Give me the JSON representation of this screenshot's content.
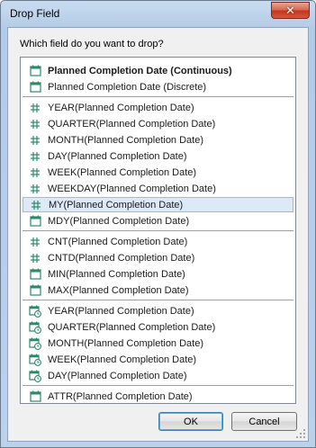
{
  "window": {
    "title": "Drop Field",
    "close_glyph": "✕"
  },
  "prompt": "Which field do you want to drop?",
  "colors": {
    "icon_green": "#2b8a67",
    "selection_bg": "#dce9f7",
    "selection_border": "#9cbde3"
  },
  "groups": [
    {
      "items": [
        {
          "label": "Planned Completion Date (Continuous)",
          "icon": "calendar-icon",
          "bold": true
        },
        {
          "label": "Planned Completion Date (Discrete)",
          "icon": "calendar-icon"
        }
      ]
    },
    {
      "items": [
        {
          "label": "YEAR(Planned Completion Date)",
          "icon": "hash-icon"
        },
        {
          "label": "QUARTER(Planned Completion Date)",
          "icon": "hash-icon"
        },
        {
          "label": "MONTH(Planned Completion Date)",
          "icon": "hash-icon"
        },
        {
          "label": "DAY(Planned Completion Date)",
          "icon": "hash-icon"
        },
        {
          "label": "WEEK(Planned Completion Date)",
          "icon": "hash-icon"
        },
        {
          "label": "WEEKDAY(Planned Completion Date)",
          "icon": "hash-icon"
        },
        {
          "label": "MY(Planned Completion Date)",
          "icon": "hash-icon",
          "selected": true
        },
        {
          "label": "MDY(Planned Completion Date)",
          "icon": "calendar-icon"
        }
      ]
    },
    {
      "items": [
        {
          "label": "CNT(Planned Completion Date)",
          "icon": "hash-icon"
        },
        {
          "label": "CNTD(Planned Completion Date)",
          "icon": "hash-icon"
        },
        {
          "label": "MIN(Planned Completion Date)",
          "icon": "calendar-icon"
        },
        {
          "label": "MAX(Planned Completion Date)",
          "icon": "calendar-icon"
        }
      ]
    },
    {
      "items": [
        {
          "label": "YEAR(Planned Completion Date)",
          "icon": "calendar-clock-icon"
        },
        {
          "label": "QUARTER(Planned Completion Date)",
          "icon": "calendar-clock-icon"
        },
        {
          "label": "MONTH(Planned Completion Date)",
          "icon": "calendar-clock-icon"
        },
        {
          "label": "WEEK(Planned Completion Date)",
          "icon": "calendar-clock-icon"
        },
        {
          "label": "DAY(Planned Completion Date)",
          "icon": "calendar-clock-icon"
        }
      ]
    },
    {
      "items": [
        {
          "label": "ATTR(Planned Completion Date)",
          "icon": "calendar-icon"
        }
      ]
    }
  ],
  "buttons": {
    "ok": "OK",
    "cancel": "Cancel"
  }
}
